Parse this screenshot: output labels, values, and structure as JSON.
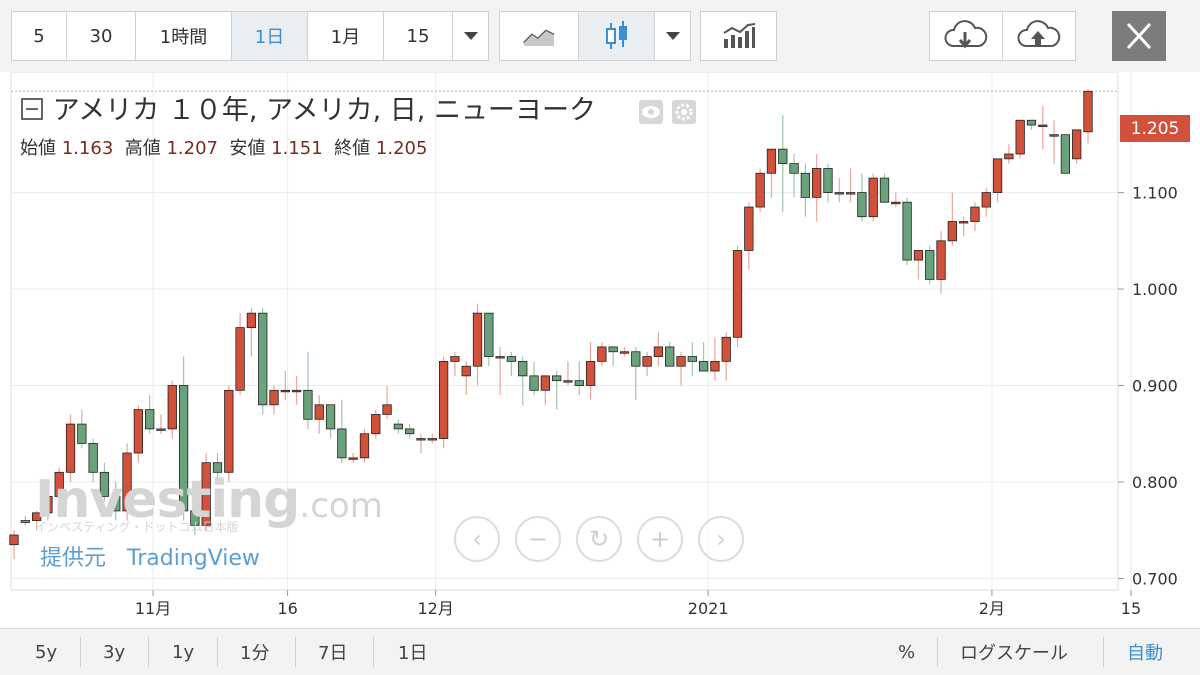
{
  "toolbar": {
    "intervals": [
      "5",
      "30",
      "1時間",
      "1日",
      "1月",
      "15"
    ],
    "active_interval": "1日"
  },
  "chart": {
    "title": "アメリカ １０年, アメリカ, 日, ニューヨーク",
    "ohlc": {
      "open_label": "始値",
      "open": "1.163",
      "high_label": "高値",
      "high": "1.207",
      "low_label": "安値",
      "low": "1.151",
      "close_label": "終値",
      "close": "1.205"
    },
    "last_price": "1.205",
    "colors": {
      "up": "#d2513a",
      "down": "#6aa27c",
      "grid": "#ececec",
      "price_line": "#e0a08f"
    }
  },
  "chart_data": {
    "type": "candlestick",
    "x_tick_labels": [
      "11月",
      "16",
      "12月",
      "2021",
      "2月",
      "15"
    ],
    "y_tick_labels": [
      "1.205",
      "1.100",
      "1.000",
      "0.900",
      "0.800",
      "0.700"
    ],
    "ylim": [
      0.688,
      1.225
    ],
    "grid": true,
    "candles": [
      [
        0.735,
        0.75,
        0.72,
        0.745
      ],
      [
        0.76,
        0.765,
        0.755,
        0.758
      ],
      [
        0.76,
        0.77,
        0.75,
        0.768
      ],
      [
        0.768,
        0.79,
        0.76,
        0.785
      ],
      [
        0.785,
        0.815,
        0.78,
        0.81
      ],
      [
        0.81,
        0.87,
        0.8,
        0.86
      ],
      [
        0.86,
        0.875,
        0.835,
        0.84
      ],
      [
        0.84,
        0.845,
        0.8,
        0.81
      ],
      [
        0.81,
        0.82,
        0.78,
        0.785
      ],
      [
        0.785,
        0.8,
        0.76,
        0.77
      ],
      [
        0.77,
        0.84,
        0.76,
        0.83
      ],
      [
        0.83,
        0.88,
        0.82,
        0.875
      ],
      [
        0.875,
        0.89,
        0.85,
        0.855
      ],
      [
        0.855,
        0.87,
        0.85,
        0.855
      ],
      [
        0.855,
        0.905,
        0.845,
        0.9
      ],
      [
        0.9,
        0.93,
        0.76,
        0.77
      ],
      [
        0.77,
        0.78,
        0.745,
        0.755
      ],
      [
        0.755,
        0.83,
        0.75,
        0.82
      ],
      [
        0.82,
        0.83,
        0.8,
        0.81
      ],
      [
        0.81,
        0.9,
        0.8,
        0.895
      ],
      [
        0.895,
        0.975,
        0.89,
        0.96
      ],
      [
        0.96,
        0.98,
        0.93,
        0.975
      ],
      [
        0.975,
        0.98,
        0.87,
        0.88
      ],
      [
        0.88,
        0.9,
        0.87,
        0.895
      ],
      [
        0.895,
        0.915,
        0.885,
        0.895
      ],
      [
        0.895,
        0.91,
        0.88,
        0.895
      ],
      [
        0.895,
        0.935,
        0.855,
        0.865
      ],
      [
        0.865,
        0.89,
        0.85,
        0.88
      ],
      [
        0.88,
        0.88,
        0.845,
        0.855
      ],
      [
        0.855,
        0.885,
        0.82,
        0.825
      ],
      [
        0.825,
        0.83,
        0.82,
        0.825
      ],
      [
        0.825,
        0.855,
        0.82,
        0.85
      ],
      [
        0.85,
        0.875,
        0.845,
        0.87
      ],
      [
        0.87,
        0.9,
        0.865,
        0.88
      ],
      [
        0.86,
        0.865,
        0.85,
        0.855
      ],
      [
        0.855,
        0.86,
        0.845,
        0.85
      ],
      [
        0.845,
        0.85,
        0.83,
        0.845
      ],
      [
        0.845,
        0.85,
        0.84,
        0.845
      ],
      [
        0.845,
        0.93,
        0.835,
        0.925
      ],
      [
        0.925,
        0.935,
        0.91,
        0.93
      ],
      [
        0.91,
        0.925,
        0.89,
        0.92
      ],
      [
        0.92,
        0.985,
        0.9,
        0.975
      ],
      [
        0.975,
        0.975,
        0.92,
        0.93
      ],
      [
        0.93,
        0.94,
        0.89,
        0.93
      ],
      [
        0.93,
        0.935,
        0.91,
        0.925
      ],
      [
        0.925,
        0.93,
        0.88,
        0.91
      ],
      [
        0.91,
        0.925,
        0.89,
        0.895
      ],
      [
        0.895,
        0.91,
        0.88,
        0.91
      ],
      [
        0.91,
        0.915,
        0.875,
        0.905
      ],
      [
        0.905,
        0.925,
        0.9,
        0.905
      ],
      [
        0.905,
        0.925,
        0.89,
        0.9
      ],
      [
        0.9,
        0.945,
        0.885,
        0.925
      ],
      [
        0.925,
        0.945,
        0.92,
        0.94
      ],
      [
        0.94,
        0.94,
        0.92,
        0.935
      ],
      [
        0.935,
        0.94,
        0.93,
        0.935
      ],
      [
        0.935,
        0.94,
        0.885,
        0.92
      ],
      [
        0.92,
        0.935,
        0.91,
        0.93
      ],
      [
        0.93,
        0.955,
        0.92,
        0.94
      ],
      [
        0.94,
        0.945,
        0.92,
        0.92
      ],
      [
        0.92,
        0.935,
        0.9,
        0.93
      ],
      [
        0.93,
        0.945,
        0.91,
        0.925
      ],
      [
        0.925,
        0.945,
        0.915,
        0.915
      ],
      [
        0.915,
        0.95,
        0.905,
        0.925
      ],
      [
        0.925,
        0.955,
        0.905,
        0.95
      ],
      [
        0.95,
        1.045,
        0.94,
        1.04
      ],
      [
        1.04,
        1.09,
        1.02,
        1.085
      ],
      [
        1.085,
        1.125,
        1.08,
        1.12
      ],
      [
        1.12,
        1.14,
        1.095,
        1.145
      ],
      [
        1.145,
        1.18,
        1.08,
        1.13
      ],
      [
        1.13,
        1.14,
        1.095,
        1.12
      ],
      [
        1.12,
        1.13,
        1.075,
        1.095
      ],
      [
        1.095,
        1.14,
        1.07,
        1.125
      ],
      [
        1.125,
        1.13,
        1.09,
        1.1
      ],
      [
        1.1,
        1.115,
        1.09,
        1.1
      ],
      [
        1.1,
        1.125,
        1.09,
        1.1
      ],
      [
        1.1,
        1.12,
        1.07,
        1.075
      ],
      [
        1.075,
        1.12,
        1.07,
        1.115
      ],
      [
        1.115,
        1.12,
        1.09,
        1.09
      ],
      [
        1.09,
        1.1,
        1.085,
        1.09
      ],
      [
        1.09,
        1.095,
        1.025,
        1.03
      ],
      [
        1.03,
        1.04,
        1.01,
        1.04
      ],
      [
        1.04,
        1.045,
        1.005,
        1.01
      ],
      [
        1.01,
        1.06,
        0.995,
        1.05
      ],
      [
        1.05,
        1.1,
        1.045,
        1.07
      ],
      [
        1.07,
        1.075,
        1.055,
        1.07
      ],
      [
        1.07,
        1.09,
        1.06,
        1.085
      ],
      [
        1.085,
        1.105,
        1.075,
        1.1
      ],
      [
        1.1,
        1.135,
        1.09,
        1.135
      ],
      [
        1.135,
        1.15,
        1.13,
        1.14
      ],
      [
        1.14,
        1.175,
        1.135,
        1.175
      ],
      [
        1.175,
        1.175,
        1.165,
        1.17
      ],
      [
        1.17,
        1.19,
        1.145,
        1.17
      ],
      [
        1.16,
        1.175,
        1.13,
        1.16
      ],
      [
        1.16,
        1.16,
        1.12,
        1.12
      ],
      [
        1.135,
        1.165,
        1.13,
        1.165
      ],
      [
        1.163,
        1.207,
        1.151,
        1.205
      ]
    ]
  },
  "overlay": {
    "watermark_logo": "Investing",
    "watermark_suffix": ".com",
    "watermark_sub": "インベスティング・ドットコム日本版",
    "provider_label": "提供元",
    "provider_name": "TradingView"
  },
  "bottom_bar": {
    "ranges": [
      "5y",
      "3y",
      "1y",
      "1分",
      "7日",
      "1日"
    ],
    "percent": "%",
    "log_scale": "ログスケール",
    "auto": "自動"
  }
}
